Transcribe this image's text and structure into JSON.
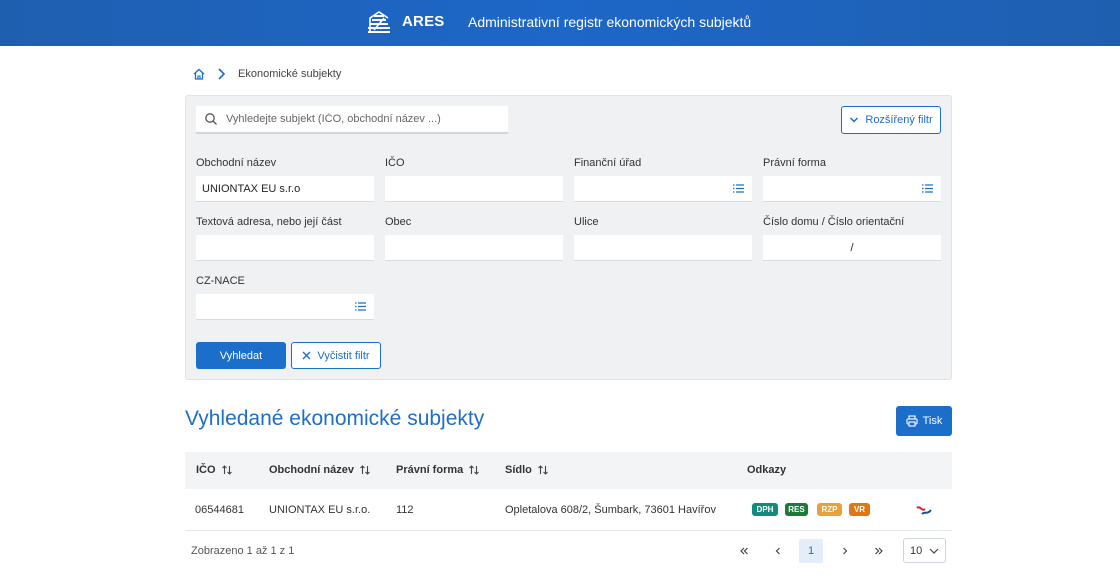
{
  "header": {
    "brand": "ARES",
    "title": "Administrativní registr ekonomických subjektů"
  },
  "breadcrumb": {
    "home_icon": "home-icon",
    "current": "Ekonomické subjekty"
  },
  "search": {
    "placeholder": "Vyhledejte subjekt (IČO, obchodní název ...)",
    "value": "",
    "advanced_filter_label": "Rozšířený filtr"
  },
  "filter": {
    "obchodni_nazev": {
      "label": "Obchodní název",
      "value": "UNIONTAX EU s.r.o"
    },
    "ico": {
      "label": "IČO",
      "value": ""
    },
    "financni_urad": {
      "label": "Finanční úřad",
      "value": ""
    },
    "pravni_forma": {
      "label": "Právní forma",
      "value": ""
    },
    "textova_adresa": {
      "label": "Textová adresa, nebo její část",
      "value": ""
    },
    "obec": {
      "label": "Obec",
      "value": ""
    },
    "ulice": {
      "label": "Ulice",
      "value": ""
    },
    "cislo_domu": {
      "label": "Číslo domu / Číslo orientační",
      "value": "/"
    },
    "cz_nace": {
      "label": "CZ-NACE",
      "value": ""
    },
    "search_button": "Vyhledat",
    "clear_button": "Vyčistit filtr"
  },
  "results": {
    "title": "Vyhledané ekonomické subjekty",
    "print_button": "Tisk",
    "columns": [
      "IČO",
      "Obchodní název",
      "Právní forma",
      "Sídlo",
      "Odkazy"
    ],
    "rows": [
      {
        "ico": "06544681",
        "nazev": "UNIONTAX EU s.r.o.",
        "pravni_forma": "112",
        "sidlo": "Opletalova 608/2, Šumbark, 73601 Havířov",
        "badges": [
          "DPH",
          "RES",
          "RZP",
          "VR"
        ]
      }
    ]
  },
  "pager": {
    "info": "Zobrazeno 1 až 1 z 1",
    "current_page": "1",
    "page_size": "10"
  },
  "colors": {
    "header_blue": "#1d67c8",
    "accent": "#1b6fcb",
    "title_blue": "#1f6ec8",
    "badge_dph": "#138a7c",
    "badge_res": "#1e7a37",
    "badge_rzp": "#e6a13a",
    "badge_vr": "#e07810"
  }
}
